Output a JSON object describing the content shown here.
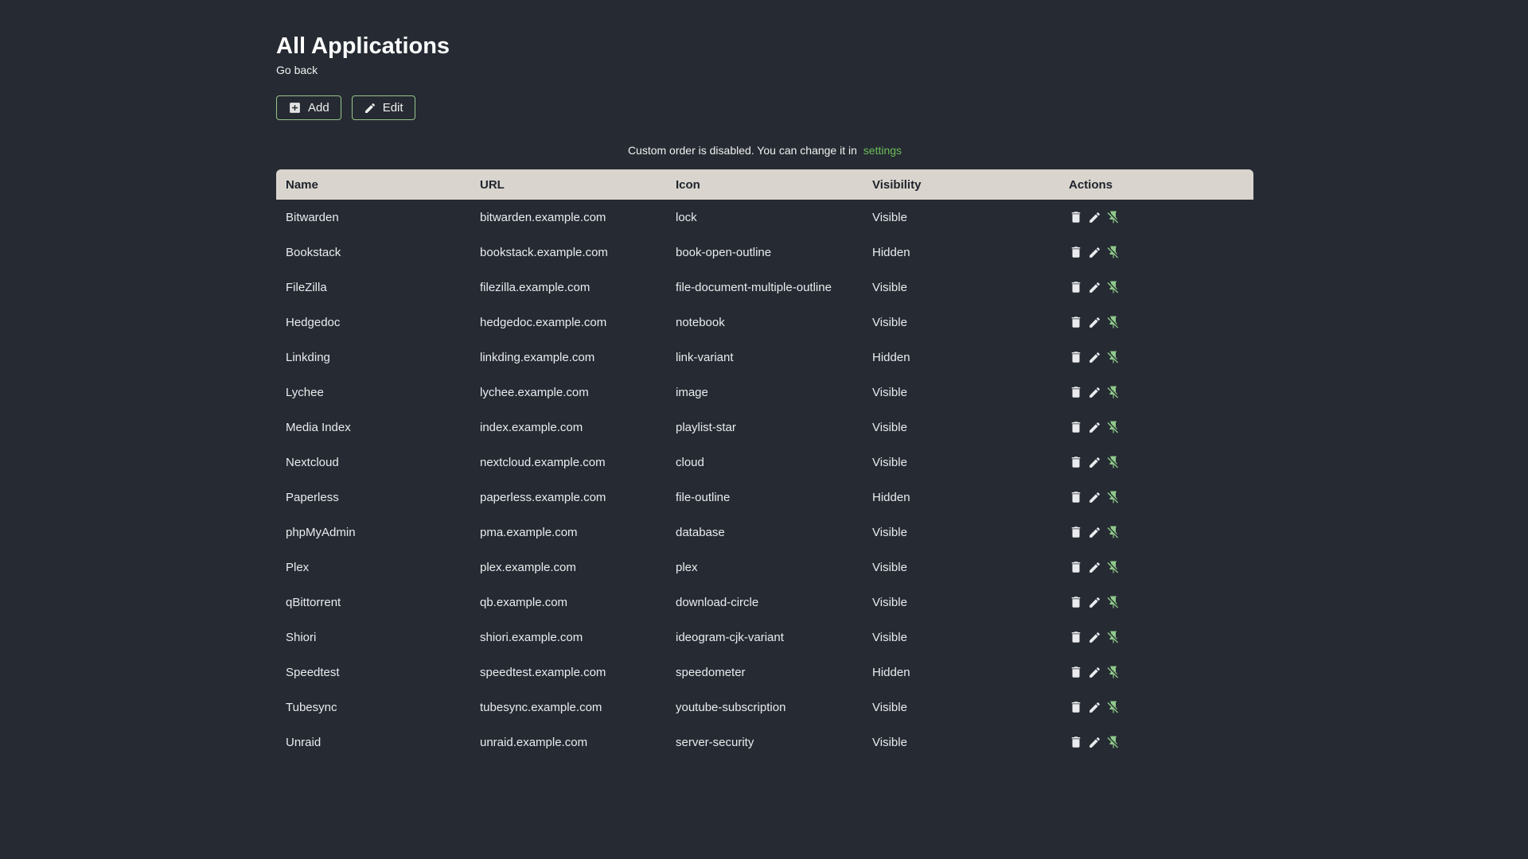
{
  "page": {
    "title": "All Applications",
    "back_label": "Go back",
    "notice_text": "Custom order is disabled. You can change it in",
    "notice_link_label": "settings"
  },
  "toolbar": {
    "add_label": "Add",
    "edit_label": "Edit"
  },
  "colors": {
    "background": "#262b33",
    "table_header_bg": "#d9d5ce",
    "table_header_text": "#20242c",
    "body_text": "#e9ebee",
    "accent_green_link": "#6dbb5a",
    "accent_green_pin": "#8fc98a",
    "button_border_green": "#97c489"
  },
  "icons": {
    "add_button": "plus-box-icon",
    "edit_button": "pencil-icon",
    "row_actions": [
      "trash-icon",
      "pencil-icon",
      "pin-off-icon"
    ]
  },
  "table": {
    "headers": [
      "Name",
      "URL",
      "Icon",
      "Visibility",
      "Actions"
    ],
    "rows": [
      {
        "name": "Bitwarden",
        "url": "bitwarden.example.com",
        "icon": "lock",
        "visibility": "Visible"
      },
      {
        "name": "Bookstack",
        "url": "bookstack.example.com",
        "icon": "book-open-outline",
        "visibility": "Hidden"
      },
      {
        "name": "FileZilla",
        "url": "filezilla.example.com",
        "icon": "file-document-multiple-outline",
        "visibility": "Visible"
      },
      {
        "name": "Hedgedoc",
        "url": "hedgedoc.example.com",
        "icon": "notebook",
        "visibility": "Visible"
      },
      {
        "name": "Linkding",
        "url": "linkding.example.com",
        "icon": "link-variant",
        "visibility": "Hidden"
      },
      {
        "name": "Lychee",
        "url": "lychee.example.com",
        "icon": "image",
        "visibility": "Visible"
      },
      {
        "name": "Media Index",
        "url": "index.example.com",
        "icon": "playlist-star",
        "visibility": "Visible"
      },
      {
        "name": "Nextcloud",
        "url": "nextcloud.example.com",
        "icon": "cloud",
        "visibility": "Visible"
      },
      {
        "name": "Paperless",
        "url": "paperless.example.com",
        "icon": "file-outline",
        "visibility": "Hidden"
      },
      {
        "name": "phpMyAdmin",
        "url": "pma.example.com",
        "icon": "database",
        "visibility": "Visible"
      },
      {
        "name": "Plex",
        "url": "plex.example.com",
        "icon": "plex",
        "visibility": "Visible"
      },
      {
        "name": "qBittorrent",
        "url": "qb.example.com",
        "icon": "download-circle",
        "visibility": "Visible"
      },
      {
        "name": "Shiori",
        "url": "shiori.example.com",
        "icon": "ideogram-cjk-variant",
        "visibility": "Visible"
      },
      {
        "name": "Speedtest",
        "url": "speedtest.example.com",
        "icon": "speedometer",
        "visibility": "Hidden"
      },
      {
        "name": "Tubesync",
        "url": "tubesync.example.com",
        "icon": "youtube-subscription",
        "visibility": "Visible"
      },
      {
        "name": "Unraid",
        "url": "unraid.example.com",
        "icon": "server-security",
        "visibility": "Visible"
      }
    ]
  }
}
